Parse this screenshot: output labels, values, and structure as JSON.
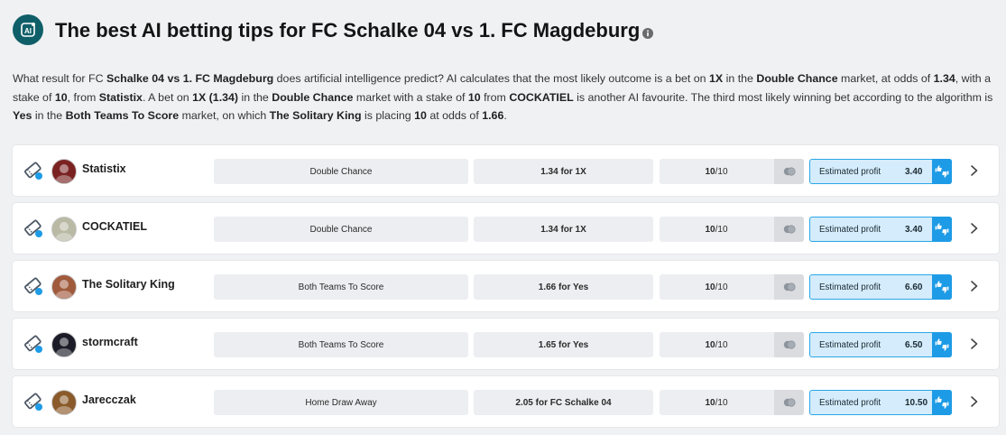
{
  "title": "The best AI betting tips for FC Schalke 04 vs 1. FC Magdeburg",
  "description": [
    {
      "t": "What result for FC ",
      "b": false
    },
    {
      "t": "Schalke 04 vs 1. FC Magdeburg",
      "b": true
    },
    {
      "t": " does artificial intelligence predict? AI calculates that the most likely outcome is a bet on ",
      "b": false
    },
    {
      "t": "1X",
      "b": true
    },
    {
      "t": " in the ",
      "b": false
    },
    {
      "t": "Double Chance",
      "b": true
    },
    {
      "t": " market, at odds of ",
      "b": false
    },
    {
      "t": "1.34",
      "b": true
    },
    {
      "t": ", with a stake of ",
      "b": false
    },
    {
      "t": "10",
      "b": true
    },
    {
      "t": ", from ",
      "b": false
    },
    {
      "t": "Statistix",
      "b": true
    },
    {
      "t": ". A bet on ",
      "b": false
    },
    {
      "t": "1X (1.34)",
      "b": true
    },
    {
      "t": " in the ",
      "b": false
    },
    {
      "t": "Double Chance",
      "b": true
    },
    {
      "t": " market with a stake of ",
      "b": false
    },
    {
      "t": "10",
      "b": true
    },
    {
      "t": " from ",
      "b": false
    },
    {
      "t": "COCKATIEL",
      "b": true
    },
    {
      "t": " is another AI favourite. The third most likely winning bet according to the algorithm is ",
      "b": false
    },
    {
      "t": "Yes",
      "b": true
    },
    {
      "t": " in the ",
      "b": false
    },
    {
      "t": "Both Teams To Score",
      "b": true
    },
    {
      "t": " market, on which ",
      "b": false
    },
    {
      "t": "The Solitary King",
      "b": true
    },
    {
      "t": " is placing ",
      "b": false
    },
    {
      "t": "10",
      "b": true
    },
    {
      "t": " at odds of ",
      "b": false
    },
    {
      "t": "1.66",
      "b": true
    },
    {
      "t": ".",
      "b": false
    }
  ],
  "profit_label": "Estimated profit",
  "colors": {
    "accent": "#1e9be6",
    "badge": "#0f5f69",
    "profit_bg": "#d4ecfb"
  },
  "tips": [
    {
      "tipster": "Statistix",
      "avatar_color": "#7a2222",
      "market": "Double Chance",
      "odds": "1.34 for 1X",
      "stake": "10",
      "stake_total": "/10",
      "profit": "3.40"
    },
    {
      "tipster": "COCKATIEL",
      "avatar_color": "#b9b9a4",
      "market": "Double Chance",
      "odds": "1.34 for 1X",
      "stake": "10",
      "stake_total": "/10",
      "profit": "3.40"
    },
    {
      "tipster": "The Solitary King",
      "avatar_color": "#a05a3c",
      "market": "Both Teams To Score",
      "odds": "1.66 for Yes",
      "stake": "10",
      "stake_total": "/10",
      "profit": "6.60"
    },
    {
      "tipster": "stormcraft",
      "avatar_color": "#1c1c28",
      "market": "Both Teams To Score",
      "odds": "1.65 for Yes",
      "stake": "10",
      "stake_total": "/10",
      "profit": "6.50"
    },
    {
      "tipster": "Jarecczak",
      "avatar_color": "#8a5a2a",
      "market": "Home Draw Away",
      "odds": "2.05 for FC Schalke 04",
      "stake": "10",
      "stake_total": "/10",
      "profit": "10.50"
    }
  ]
}
